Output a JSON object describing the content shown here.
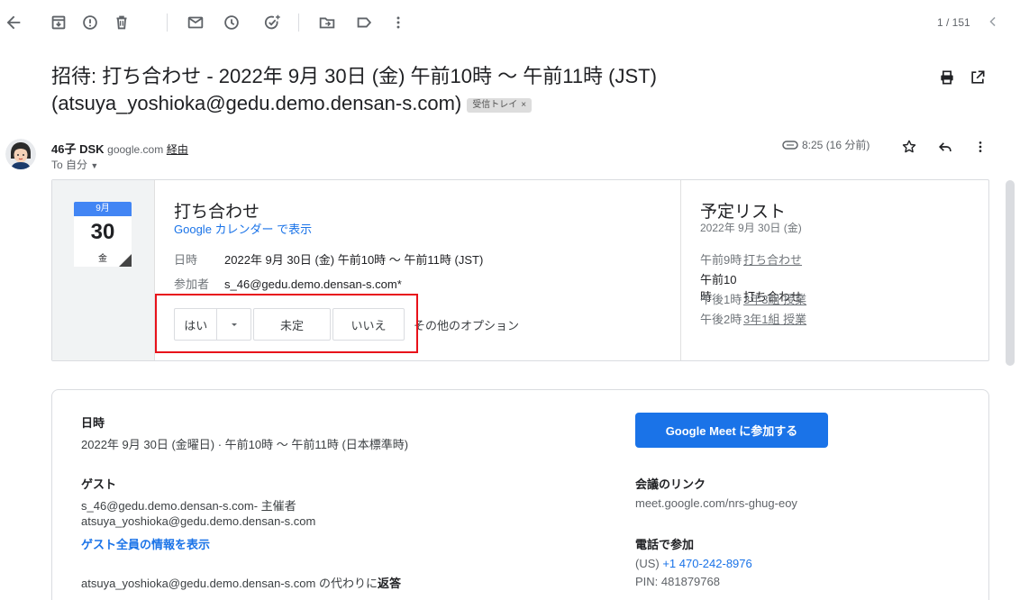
{
  "toolbar": {
    "icons": [
      "back-icon",
      "archive-icon",
      "report-spam-icon",
      "delete-icon",
      "mark-unread-icon",
      "snooze-icon",
      "add-task-icon",
      "move-to-icon",
      "label-icon",
      "more-vert-icon"
    ],
    "pager": "1 / 151"
  },
  "subject": {
    "text": "招待: 打ち合わせ - 2022年 9月 30日 (金) 午前10時 ～ 午前11時 (JST) (atsuya_yoshioka@gedu.demo.densan-s.com)",
    "label": "受信トレイ",
    "label_close": "×"
  },
  "sender": {
    "name": "46子 DSK",
    "domain": "google.com",
    "via": "経由",
    "to": "To 自分",
    "time": "8:25 (16 分前)"
  },
  "invite": {
    "cal_month": "9月",
    "cal_day": "30",
    "cal_weekday": "金",
    "title": "打ち合わせ",
    "view_link": "Google カレンダー で表示",
    "when_label": "日時",
    "when_value": "2022年 9月 30日 (金) 午前10時 ～ 午前11時 (JST)",
    "who_label": "参加者",
    "who_value": "s_46@gedu.demo.densan-s.com*",
    "rsvp_yes": "はい",
    "rsvp_maybe": "未定",
    "rsvp_no": "いいえ",
    "more_options": "その他のオプション",
    "agenda_title": "予定リスト",
    "agenda_date": "2022年 9月 30日 (金)",
    "agenda": [
      {
        "time": "午前9時",
        "name": "打ち合わせ"
      },
      {
        "time": "午前10時",
        "name": "打ち合わせ"
      },
      {
        "time": "午後1時",
        "name": "3年3組 授業"
      },
      {
        "time": "午後2時",
        "name": "3年1組 授業"
      }
    ]
  },
  "details": {
    "when_heading": "日時",
    "when_value": "2022年 9月 30日 (金曜日) · 午前10時 ～ 午前11時 (日本標準時)",
    "guests_heading": "ゲスト",
    "guest1": "s_46@gedu.demo.densan-s.com- 主催者",
    "guest2": "atsuya_yoshioka@gedu.demo.densan-s.com",
    "show_all_guests": "ゲスト全員の情報を表示",
    "reply_prefix": "atsuya_yoshioka@gedu.demo.densan-s.com の代わりに",
    "reply_action": "返答",
    "meet_button": "Google Meet に参加する",
    "meeting_link_heading": "会議のリンク",
    "meeting_link": "meet.google.com/nrs-ghug-eoy",
    "phone_heading": "電話で参加",
    "phone_country": "(US)",
    "phone_number": "+1 470-242-8976",
    "pin": "PIN: 481879768"
  },
  "colors": {
    "accent_blue": "#1a73e8",
    "calendar_blue": "#4285f4",
    "highlight_red": "#e8111a"
  }
}
